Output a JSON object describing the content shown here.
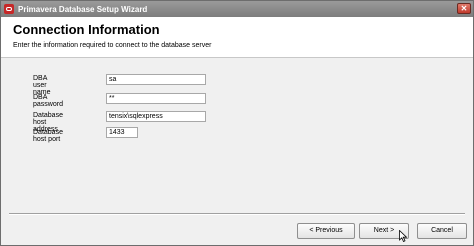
{
  "window": {
    "title": "Primavera Database Setup Wizard",
    "close_symbol": "✕"
  },
  "header": {
    "title": "Connection Information",
    "description": "Enter the information required to connect to the database server"
  },
  "form": {
    "dba_user_label": "DBA user name",
    "dba_user_value": "sa",
    "dba_password_label": "DBA password",
    "dba_password_value": "**",
    "db_host_label": "Database host address",
    "db_host_value": "tensix\\sqlexpress",
    "db_port_label": "Database host port",
    "db_port_value": "1433"
  },
  "buttons": {
    "previous": "< Previous",
    "next": "Next >",
    "cancel": "Cancel"
  }
}
